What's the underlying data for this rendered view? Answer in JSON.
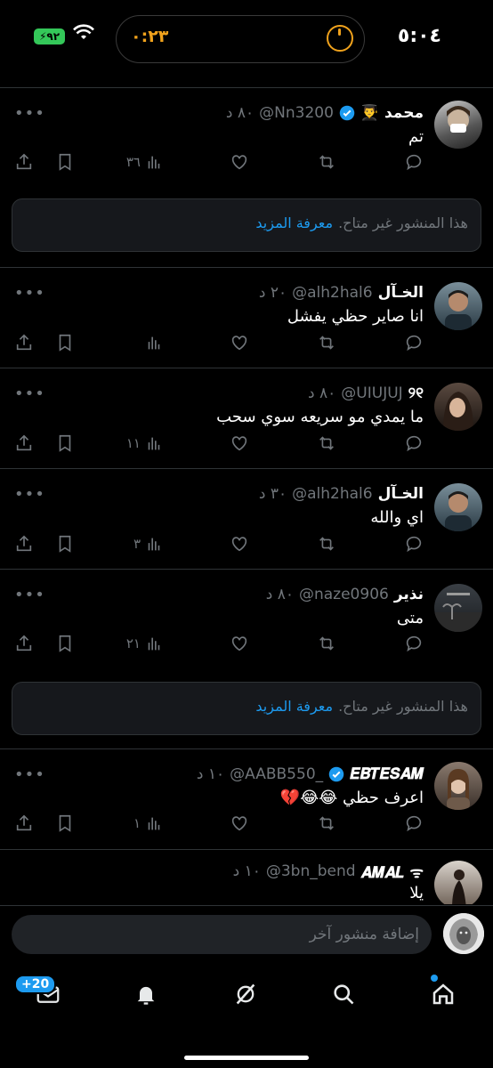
{
  "status_bar": {
    "time": "٥:٠٤",
    "timer": "٠:٢٣",
    "battery": "٩٢"
  },
  "posts": [
    {
      "name": "محمد 👨‍🎓",
      "verified": true,
      "handle": "@Nn3200",
      "time": "٨٠ د",
      "text": "تم",
      "views": "٣٦"
    },
    {
      "name": "الخـآل",
      "verified": false,
      "handle": "@alh2hal6",
      "time": "٢٠ د",
      "text": "انا صاير حظي يفشل",
      "views": ""
    },
    {
      "name": "୨୧",
      "verified": false,
      "handle": "@UIUJUJ",
      "time": "٨٠ د",
      "text": "ما يمدي مو سريعه سوي سحب",
      "views": "١١"
    },
    {
      "name": "الخـآل",
      "verified": false,
      "handle": "@alh2hal6",
      "time": "٣٠ د",
      "text": "اي والله",
      "views": "٣"
    },
    {
      "name": "نذير",
      "verified": false,
      "handle": "@naze0906",
      "time": "٨٠ د",
      "text": "متى",
      "views": "٢١"
    },
    {
      "name": "𝑬𝑩𝑻𝑬𝑺𝑨𝑴",
      "verified": true,
      "handle": "@AABB550_",
      "time": "١٠ د",
      "text": "اعرف حظي 😂😂💔",
      "views": "١"
    },
    {
      "name": "𝑨𝑴𝑨𝑳 ᯤ",
      "verified": false,
      "handle": "@3bn_bend",
      "time": "١٠ د",
      "text": "يلا",
      "views": ""
    }
  ],
  "unavailable": {
    "text": "هذا المنشور غير متاح.",
    "link": "معرفة المزيد"
  },
  "composer": {
    "placeholder": "إضافة منشور آخر"
  },
  "tabbar": {
    "badge": "+20"
  },
  "colors": {
    "accent": "#1d9bf0",
    "background": "#000000",
    "muted": "#71767b",
    "timer": "#f0a21c"
  }
}
